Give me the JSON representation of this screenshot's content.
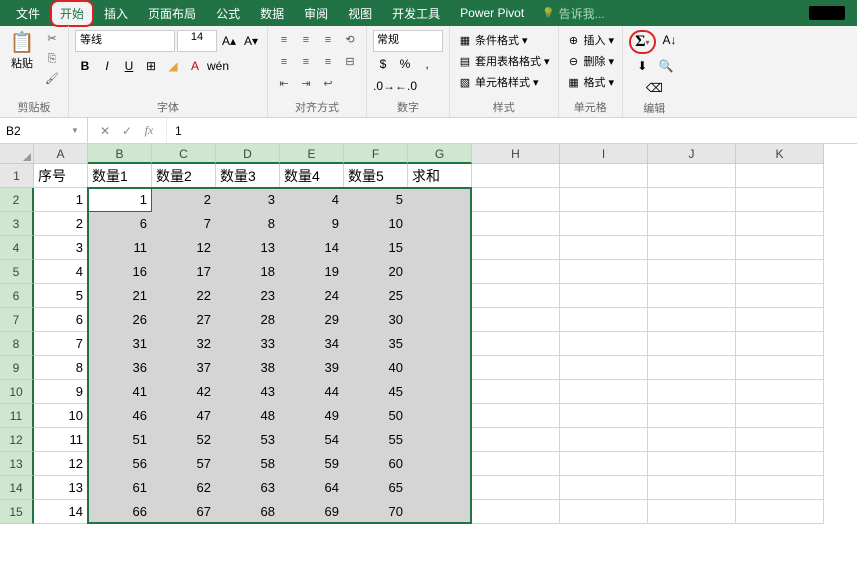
{
  "menu": {
    "file": "文件",
    "home": "开始",
    "insert": "插入",
    "pagelayout": "页面布局",
    "formulas": "公式",
    "data": "数据",
    "review": "审阅",
    "view": "视图",
    "developer": "开发工具",
    "powerpivot": "Power Pivot",
    "tellme": "告诉我..."
  },
  "ribbon": {
    "clipboard": {
      "paste": "粘贴",
      "label": "剪贴板"
    },
    "font": {
      "name": "等线",
      "size": "14",
      "label": "字体"
    },
    "alignment": {
      "label": "对齐方式"
    },
    "number": {
      "format": "常规",
      "label": "数字"
    },
    "styles": {
      "cond": "条件格式",
      "table": "套用表格格式",
      "cell": "单元格样式",
      "label": "样式"
    },
    "cells": {
      "insert": "插入",
      "delete": "删除",
      "format": "格式",
      "label": "单元格"
    },
    "editing": {
      "label": "编辑"
    }
  },
  "formulabar": {
    "namebox": "B2",
    "value": "1"
  },
  "columns": [
    "A",
    "B",
    "C",
    "D",
    "E",
    "F",
    "G",
    "H",
    "I",
    "J",
    "K"
  ],
  "headers": [
    "序号",
    "数量1",
    "数量2",
    "数量3",
    "数量4",
    "数量5",
    "求和"
  ],
  "chart_data": {
    "type": "table",
    "columns": [
      "序号",
      "数量1",
      "数量2",
      "数量3",
      "数量4",
      "数量5",
      "求和"
    ],
    "rows": [
      [
        1,
        1,
        2,
        3,
        4,
        5,
        null
      ],
      [
        2,
        6,
        7,
        8,
        9,
        10,
        null
      ],
      [
        3,
        11,
        12,
        13,
        14,
        15,
        null
      ],
      [
        4,
        16,
        17,
        18,
        19,
        20,
        null
      ],
      [
        5,
        21,
        22,
        23,
        24,
        25,
        null
      ],
      [
        6,
        26,
        27,
        28,
        29,
        30,
        null
      ],
      [
        7,
        31,
        32,
        33,
        34,
        35,
        null
      ],
      [
        8,
        36,
        37,
        38,
        39,
        40,
        null
      ],
      [
        9,
        41,
        42,
        43,
        44,
        45,
        null
      ],
      [
        10,
        46,
        47,
        48,
        49,
        50,
        null
      ],
      [
        11,
        51,
        52,
        53,
        54,
        55,
        null
      ],
      [
        12,
        56,
        57,
        58,
        59,
        60,
        null
      ],
      [
        13,
        61,
        62,
        63,
        64,
        65,
        null
      ],
      [
        14,
        66,
        67,
        68,
        69,
        70,
        null
      ]
    ]
  }
}
